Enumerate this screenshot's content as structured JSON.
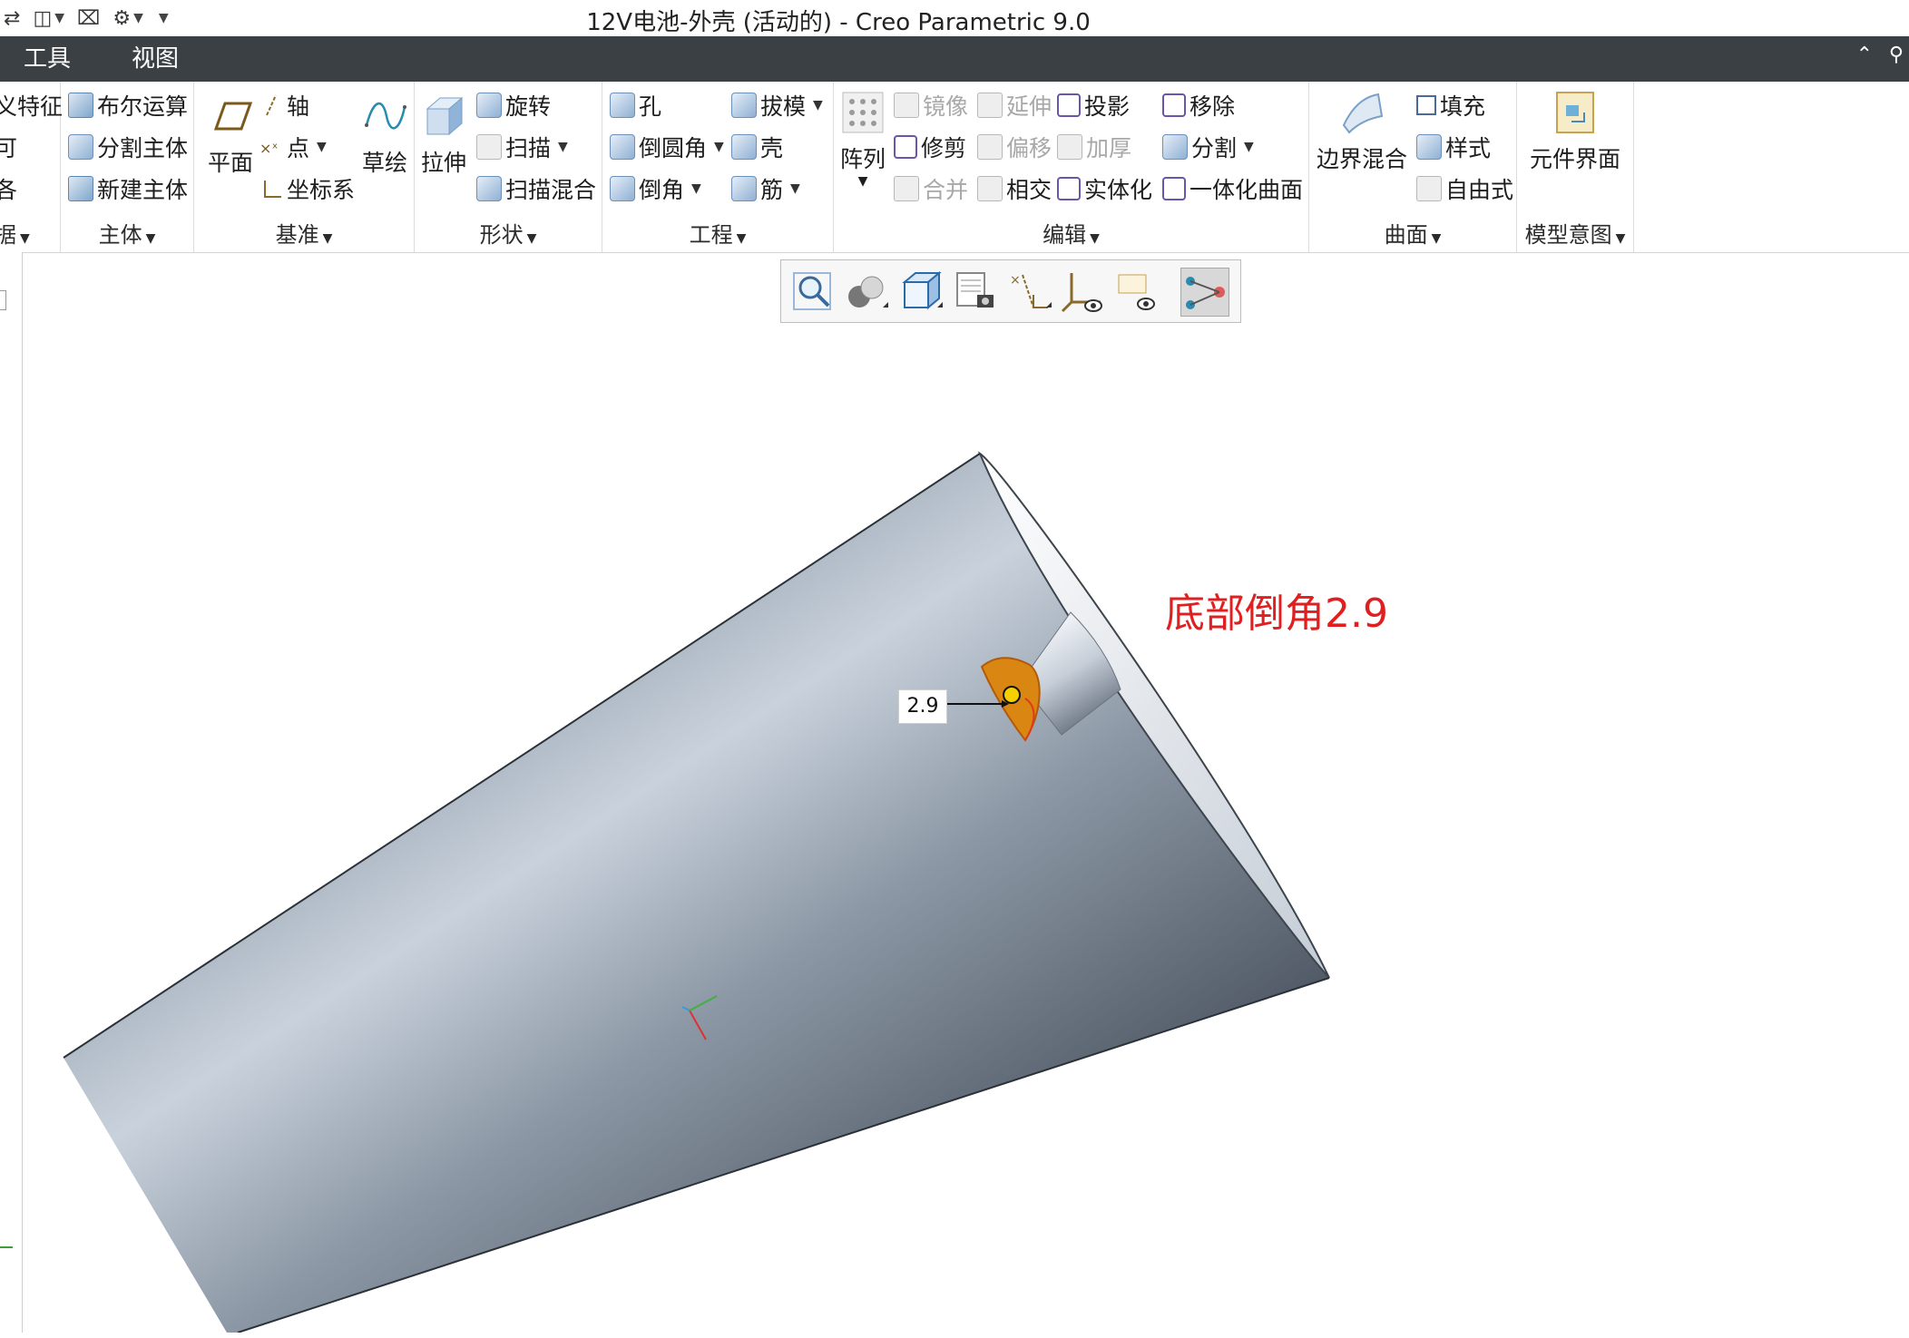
{
  "window": {
    "title": "12V电池-外壳 (活动的) - Creo Parametric 9.0"
  },
  "menu": {
    "tools": "工具",
    "view": "视图"
  },
  "ribbon": {
    "partial_left": {
      "item1": "义特征",
      "item2": "可",
      "item3": "各",
      "label": "据"
    },
    "body": {
      "boolean": "布尔运算",
      "split_body": "分割主体",
      "new_body": "新建主体",
      "label": "主体"
    },
    "datum": {
      "plane": "平面",
      "axis": "轴",
      "point": "点",
      "csys": "坐标系",
      "sketch": "草绘",
      "label": "基准"
    },
    "shapes": {
      "extrude": "拉伸",
      "revolve": "旋转",
      "sweep": "扫描",
      "swept_blend": "扫描混合",
      "label": "形状"
    },
    "engineering": {
      "hole": "孔",
      "round": "倒圆角",
      "chamfer": "倒角",
      "draft": "拔模",
      "shell": "壳",
      "rib": "筋",
      "label": "工程"
    },
    "editing": {
      "pattern": "阵列",
      "mirror": "镜像",
      "extend": "延伸",
      "project": "投影",
      "remove": "移除",
      "trim": "修剪",
      "offset": "偏移",
      "thicken": "加厚",
      "split": "分割",
      "merge": "合并",
      "intersect": "相交",
      "solidify": "实体化",
      "unify": "一体化曲面",
      "label": "编辑"
    },
    "surfaces": {
      "boundary_blend": "边界混合",
      "fill": "填充",
      "style": "样式",
      "freestyle": "自由式",
      "label": "曲面"
    },
    "model_intent": {
      "component_interface": "元件界面",
      "label": "模型意图"
    }
  },
  "viewport": {
    "annotation": "底部倒角2.9",
    "dimension": "2.9"
  },
  "colors": {
    "menubar": "#3b4045",
    "annotation": "#e02020",
    "chamfer_face": "#d98612",
    "body_light": "#b7c2cf",
    "body_dark": "#4f5864"
  }
}
